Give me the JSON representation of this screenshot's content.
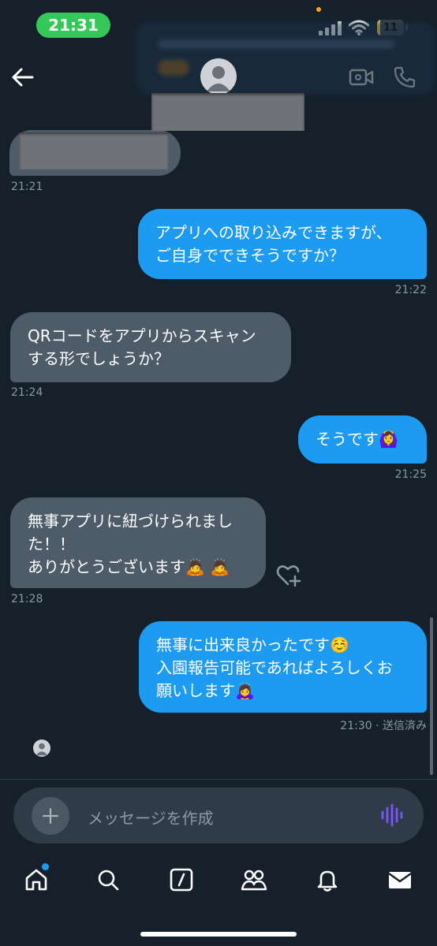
{
  "status_bar": {
    "time": "21:31",
    "battery_level": "11",
    "battery_fraction": 0.11,
    "accent_color": "#34c759"
  },
  "header": {
    "back_icon": "arrow-left-icon",
    "avatar_icon": "default-avatar-icon",
    "video_icon": "video-camera-icon",
    "call_icon": "phone-icon"
  },
  "messages": [
    {
      "side": "in",
      "text": "",
      "redacted": true,
      "time": "21:21"
    },
    {
      "side": "out",
      "text": "アプリへの取り込みできますが、\nご自身でできそうですか？",
      "time": "21:22"
    },
    {
      "side": "in",
      "text": "QRコードをアプリからスキャン\nする形でしょうか？",
      "time": "21:24"
    },
    {
      "side": "out",
      "text": "そうです🙆‍♀️",
      "time": "21:25"
    },
    {
      "side": "in",
      "text": "無事アプリに紐づけられまし\nた！！\nありがとうございます🙇 🙇",
      "time": "21:28",
      "reaction_icon": "heart-plus-icon"
    },
    {
      "side": "out",
      "text": "無事に出来良かったです☺️\n入園報告可能であればよろしくお\n願いします🙇‍♀️",
      "time": "21:30 · 送信済み"
    }
  ],
  "composer": {
    "placeholder": "メッセージを作成",
    "add_icon": "plus-icon",
    "voice_icon": "voice-wave-icon"
  },
  "nav": {
    "items": [
      "home-icon",
      "search-icon",
      "compose-icon",
      "communities-icon",
      "bell-icon",
      "mail-icon"
    ],
    "home_badge_color": "#1d9bf0"
  },
  "colors": {
    "background": "#15202b",
    "outgoing": "#1d9bf0",
    "incoming": "#4e5b68"
  }
}
